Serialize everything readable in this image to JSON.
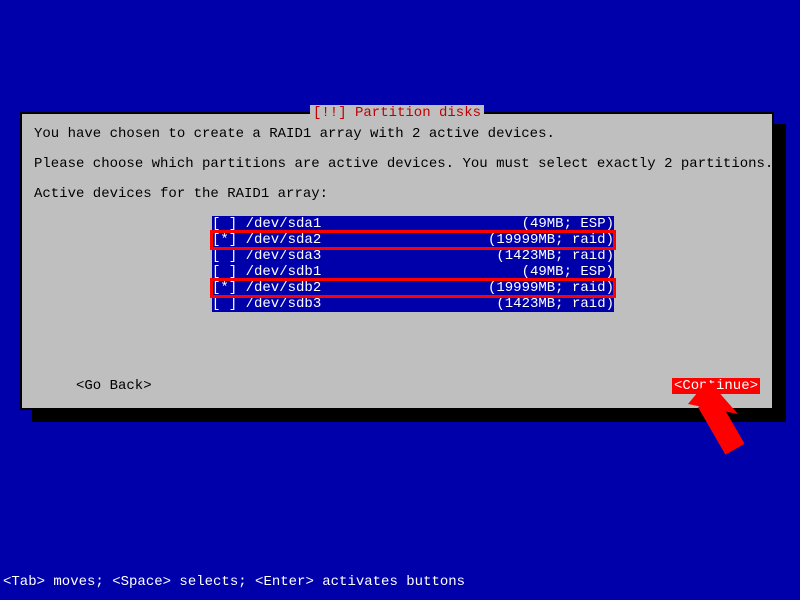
{
  "dialog": {
    "title": "[!!] Partition disks",
    "line1": "You have chosen to create a RAID1 array with 2 active devices.",
    "line2": "Please choose which partitions are active devices. You must select exactly 2 partitions.",
    "line3": "Active devices for the RAID1 array:"
  },
  "partitions": [
    {
      "checked": false,
      "dev": "/dev/sda1",
      "info": "(49MB; ESP)",
      "highlight": false
    },
    {
      "checked": true,
      "dev": "/dev/sda2",
      "info": "(19999MB; raid)",
      "highlight": true
    },
    {
      "checked": false,
      "dev": "/dev/sda3",
      "info": "(1423MB; raid)",
      "highlight": false
    },
    {
      "checked": false,
      "dev": "/dev/sdb1",
      "info": "(49MB; ESP)",
      "highlight": false
    },
    {
      "checked": true,
      "dev": "/dev/sdb2",
      "info": "(19999MB; raid)",
      "highlight": true
    },
    {
      "checked": false,
      "dev": "/dev/sdb3",
      "info": "(1423MB; raid)",
      "highlight": false
    }
  ],
  "nav": {
    "goback": "<Go Back>",
    "continue": "<Continue>"
  },
  "statusbar": "<Tab> moves; <Space> selects; <Enter> activates buttons"
}
